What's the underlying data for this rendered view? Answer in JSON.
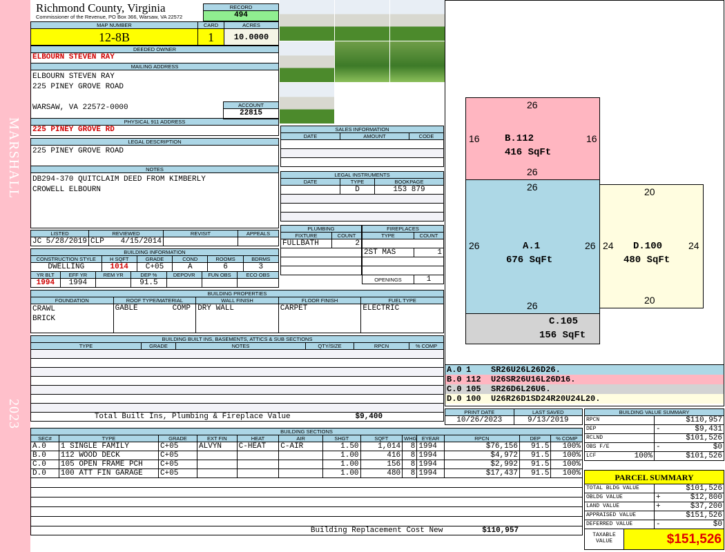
{
  "strip": {
    "district": "MARSHALL",
    "year": "2023"
  },
  "header": {
    "title": "Richmond County, Virginia",
    "subtitle": "Commissioner of the Revenue, PO Box 366, Warsaw, VA 22572",
    "record_label": "RECORD",
    "record": "494"
  },
  "parcel": {
    "map_label": "MAP NUMBER",
    "map": "12-8B",
    "card_label": "CARD",
    "card": "1",
    "acres_label": "ACRES",
    "acres": "10.0000"
  },
  "owner": {
    "label": "DEEDED OWNER",
    "name": "ELBOURN STEVEN RAY"
  },
  "mailing": {
    "label": "MAILING ADDRESS",
    "line1": "ELBOURN STEVEN RAY",
    "line2": "225 PINEY GROVE ROAD",
    "line3": "WARSAW, VA 22572-0000",
    "account_label": "ACCOUNT",
    "account": "22815"
  },
  "physical": {
    "label": "PHYSICAL 911 ADDRESS",
    "address": "225 PINEY GROVE RD"
  },
  "legal": {
    "label": "LEGAL DESCRIPTION",
    "text": "225 PINEY GROVE ROAD"
  },
  "notes": {
    "label": "NOTES",
    "line1": "DB294-370 QUITCLAIM DEED FROM KIMBERLY",
    "line2": "CROWELL ELBOURN"
  },
  "listing": {
    "headers": [
      "LISTED",
      "REVIEWED",
      "REVISIT",
      "APPEALS"
    ],
    "listed_by": "JC",
    "listed_date": "5/28/2019",
    "reviewed_by": "CLP",
    "reviewed_date": "4/15/2014"
  },
  "building_info": {
    "label": "BUILDING INFORMATION",
    "headers1": [
      "CONSTRUCTION STYLE",
      "H SQFT",
      "GRADE",
      "COND",
      "ROOMS",
      "BDRMS"
    ],
    "style": "DWELLING",
    "hsqft": "1014",
    "grade": "C+05",
    "cond": "A",
    "rooms": "6",
    "bdrms": "3",
    "headers2": [
      "YR BLT",
      "EFF YR",
      "REM YR",
      "DEP %",
      "DEPOVR",
      "FUN OBS",
      "ECO OBS"
    ],
    "yr_blt": "1994",
    "eff_yr": "1994",
    "dep": "91.5"
  },
  "sales": {
    "label": "SALES INFORMATION",
    "headers": [
      "DATE",
      "AMOUNT",
      "CODE"
    ]
  },
  "instruments": {
    "label": "LEGAL INSTRUMENTS",
    "headers": [
      "DATE",
      "TYPE",
      "BOOKPAGE"
    ],
    "type": "D",
    "bookpage": "153 879"
  },
  "plumbing": {
    "label": "PLUMBING",
    "headers": [
      "FIXTURE",
      "COUNT"
    ],
    "fixture": "FULLBATH",
    "count": "2"
  },
  "fireplaces": {
    "label": "FIREPLACES",
    "headers": [
      "TYPE",
      "COUNT"
    ],
    "type": "2ST MAS",
    "count": "1",
    "openings_label": "OPENINGS",
    "openings": "1"
  },
  "properties": {
    "label": "BUILDING PROPERTIES",
    "headers": [
      "FOUNDATION",
      "ROOF TYPE/MATERIAL",
      "WALL FINISH",
      "FLOOR FINISH",
      "FUEL TYPE"
    ],
    "foundation1": "CRAWL",
    "foundation2": "BRICK",
    "roof_type": "GABLE",
    "roof_material": "COMP SHGLS",
    "wall": "DRY WALL",
    "floor": "CARPET",
    "fuel": "ELECTRIC"
  },
  "builtins": {
    "label": "BUILDING BUILT INS, BASEMENTS, ATTICS & SUB SECTIONS",
    "headers": [
      "TYPE",
      "GRADE",
      "NOTES",
      "QTY/SIZE",
      "RPCN",
      "% COMP"
    ],
    "total_label": "Total Built Ins, Plumbing & Fireplace Value",
    "total": "$9,400"
  },
  "sections": {
    "label": "BUILDING SECTIONS",
    "headers": [
      "SEC#",
      "TYPE",
      "GRADE",
      "EXT FIN",
      "HEAT",
      "AIR",
      "SHGT",
      "SQFT",
      "WHGT",
      "EYEAR",
      "RPCN",
      "DEP",
      "% COMP"
    ],
    "rows": [
      [
        "A.0",
        "1 SINGLE FAMILY",
        "C+05",
        "ALVYN",
        "C-HEAT",
        "C-AIR",
        "1.50",
        "1,014",
        "8",
        "1994",
        "$76,156",
        "91.5",
        "100%"
      ],
      [
        "B.0",
        "112 WOOD DECK",
        "C+05",
        "",
        "",
        "",
        "1.00",
        "416",
        "8",
        "1994",
        "$4,972",
        "91.5",
        "100%"
      ],
      [
        "C.0",
        "105 OPEN FRAME PCH",
        "C+05",
        "",
        "",
        "",
        "1.00",
        "156",
        "8",
        "1994",
        "$2,992",
        "91.5",
        "100%"
      ],
      [
        "D.0",
        "100 ATT FIN GARAGE",
        "C+05",
        "",
        "",
        "",
        "1.00",
        "480",
        "8",
        "1994",
        "$17,437",
        "91.5",
        "100%"
      ]
    ],
    "total_label": "Building Replacement Cost New",
    "total": "$110,957"
  },
  "sketch": {
    "shapes": [
      {
        "id": "B.112",
        "area": "416 SqFt",
        "top": "26",
        "bottom": "26",
        "left": "16",
        "right": "16"
      },
      {
        "id": "A.1",
        "area": "676 SqFt",
        "top": "26",
        "bottom": "26",
        "left": "26",
        "right": "26"
      },
      {
        "id": "C.105",
        "area": "156 SqFt"
      },
      {
        "id": "D.100",
        "area": "480 SqFt",
        "top": "20",
        "bottom": "20",
        "left": "24",
        "right": "24"
      }
    ],
    "vectors": [
      [
        "A.0",
        "1",
        "SR26U26L26D26."
      ],
      [
        "B.0",
        "112",
        "U26SR26U16L26D16."
      ],
      [
        "C.0",
        "105",
        "SR26D6L26U6."
      ],
      [
        "D.0",
        "100",
        "U26R26D1SD24R20U24L20."
      ]
    ],
    "vector_colors": [
      "#add8e6",
      "#ffb6c1",
      "#d3d3d3",
      "#fffde0"
    ]
  },
  "dates": {
    "print_label": "PRINT DATE",
    "print": "10/26/2023",
    "saved_label": "LAST SAVED",
    "saved": "9/13/2019"
  },
  "value_summary": {
    "label": "BUILDING VALUE SUMMARY",
    "rows": [
      [
        "RPCN",
        "",
        "",
        "$110,957"
      ],
      [
        "DEP",
        "",
        "-",
        "$9,431"
      ],
      [
        "RCLND",
        "",
        "",
        "$101,526"
      ],
      [
        "OBS F/E",
        "",
        "-",
        "$0"
      ],
      [
        "LCF",
        "100%",
        "",
        "$101,526"
      ]
    ]
  },
  "parcel_summary": {
    "label": "PARCEL SUMMARY",
    "rows": [
      [
        "TOTAL BLDG VALUE",
        "",
        "$101,526"
      ],
      [
        "OBLDG VALUE",
        "+",
        "$12,800"
      ],
      [
        "LAND VALUE",
        "+",
        "$37,200"
      ],
      [
        "APPRAISED VALUE",
        "",
        "$151,526"
      ],
      [
        "DEFERRED VALUE",
        "-",
        "$0"
      ]
    ],
    "taxable_label1": "TAXABLE",
    "taxable_label2": "VALUE",
    "taxable": "$151,526"
  }
}
